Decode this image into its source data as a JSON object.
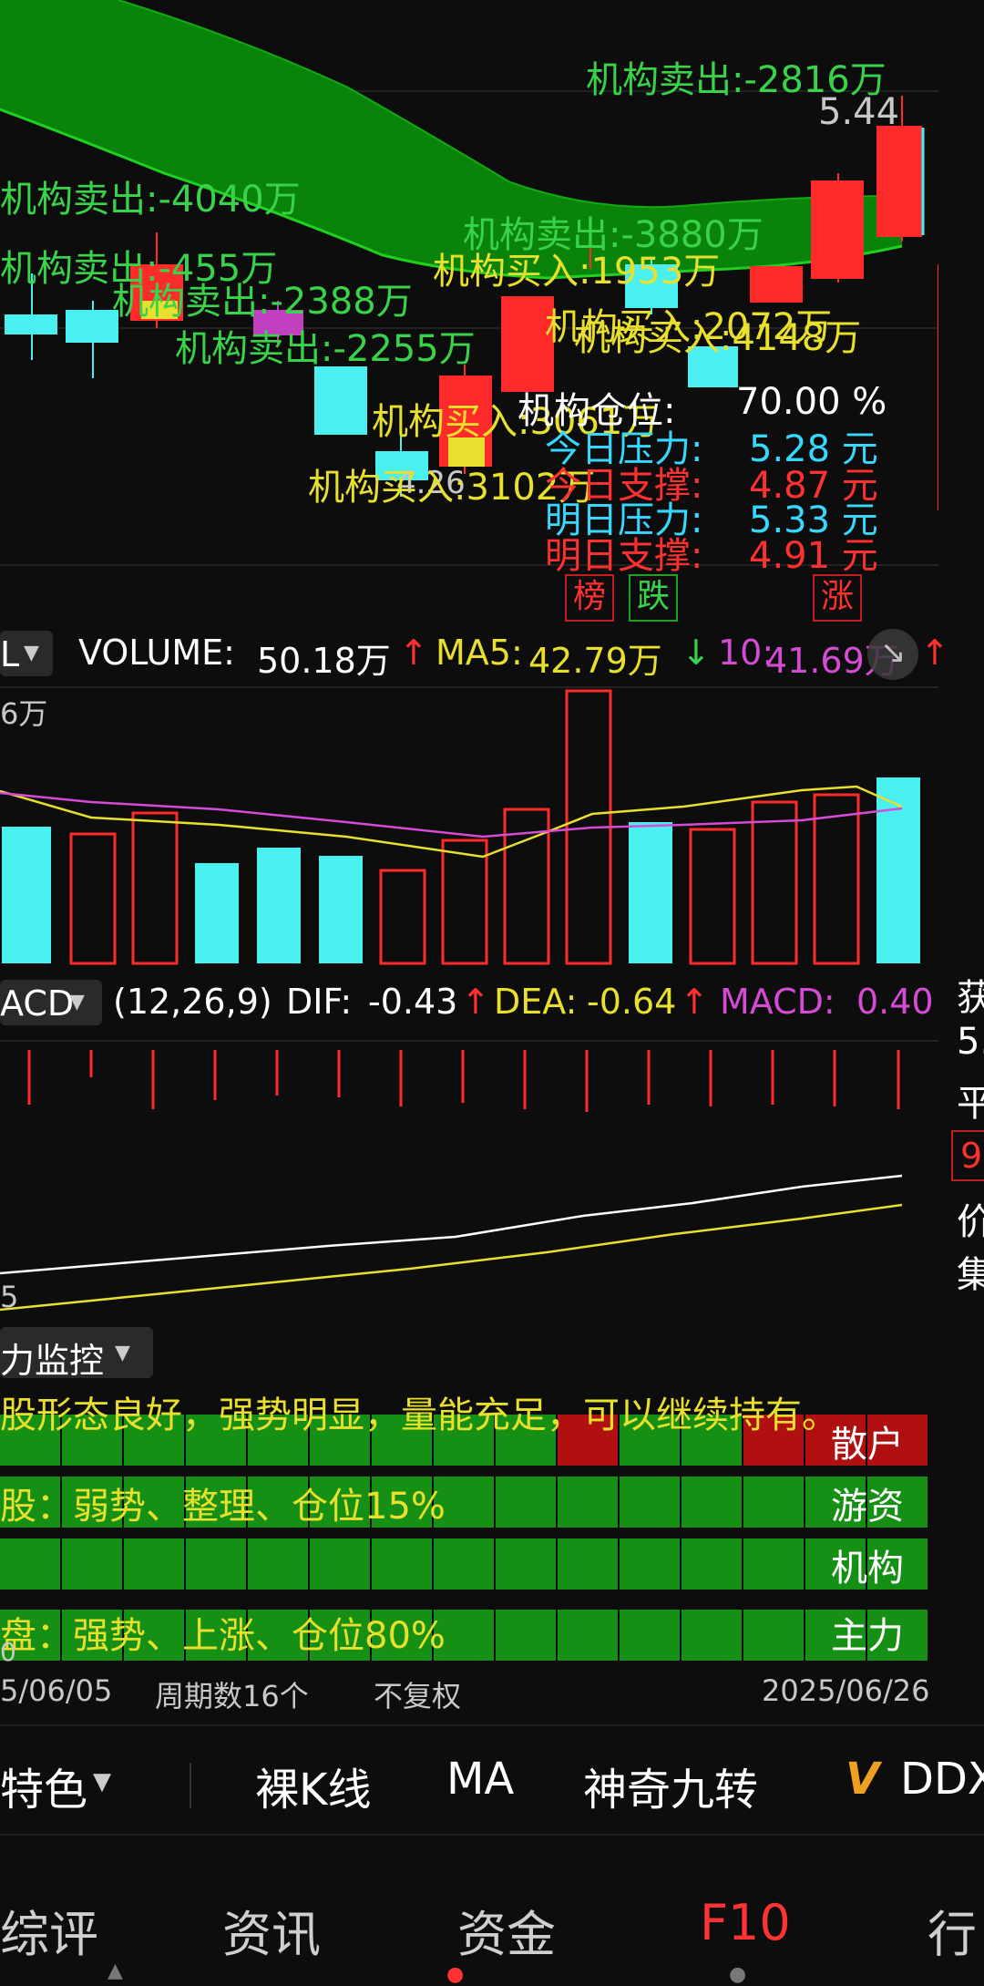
{
  "price_chart": {
    "price_high": "5.44",
    "price_low": "4.26",
    "annotations": [
      {
        "text": "机构卖出:-2816万",
        "color": "green"
      },
      {
        "text": "机构卖出:-4040万",
        "color": "green"
      },
      {
        "text": "机构卖出:-3880万",
        "color": "green"
      },
      {
        "text": "机构卖出:-455万",
        "color": "green"
      },
      {
        "text": "机构买入:1953万",
        "color": "yellow"
      },
      {
        "text": "机构卖出:-2388万",
        "color": "green"
      },
      {
        "text": "机构买入:2072万",
        "color": "yellow"
      },
      {
        "text": "机构买入:4148万",
        "color": "yellow"
      },
      {
        "text": "机构卖出:-2255万",
        "color": "green"
      },
      {
        "text": "机构买入:3061万",
        "color": "yellow"
      },
      {
        "text": "机构买入:3102万",
        "color": "yellow"
      }
    ],
    "stats": {
      "position_label": "机构仓位:",
      "position_value": "70.00 %",
      "today_pressure_label": "今日压力:",
      "today_pressure_value": "5.28 元",
      "today_support_label": "今日支撑:",
      "today_support_value": "4.87 元",
      "tomorrow_pressure_label": "明日压力:",
      "tomorrow_pressure_value": "5.33 元",
      "tomorrow_support_label": "明日支撑:",
      "tomorrow_support_value": "4.91 元"
    },
    "badges": [
      "榜",
      "跌",
      "涨"
    ]
  },
  "volume_panel": {
    "selector": "L",
    "volume_label": "VOLUME:",
    "volume_value": "50.18万",
    "ma5_label": "MA5:",
    "ma5_value": "42.79万",
    "ma10_label": "10:",
    "ma10_value": "41.69万",
    "axis_label": "6万"
  },
  "macd_panel": {
    "selector": "ACD",
    "params": "(12,26,9)",
    "dif_label": "DIF:",
    "dif_value": "-0.43",
    "dea_label": "DEA:",
    "dea_value": "-0.64",
    "macd_label": "MACD:",
    "macd_value": "0.40",
    "axis_label": "5"
  },
  "side_panel": [
    "获",
    "5.",
    "平",
    "9",
    "价",
    "集"
  ],
  "monitor_panel": {
    "title": "力监控",
    "message": "股形态良好，强势明显，量能充足，可以继续持有。",
    "rows": [
      {
        "label": "散户",
        "text": ""
      },
      {
        "label": "游资",
        "text": "股：弱势、整理、仓位15%"
      },
      {
        "label": "机构",
        "text": ""
      },
      {
        "label": "主力",
        "text": "盘：强势、上涨、仓位80%"
      }
    ],
    "axis_label": "0"
  },
  "footer_info": {
    "start_date": "5/06/05",
    "period_count": "周期数16个",
    "adjust": "不复权",
    "end_date": "2025/06/26"
  },
  "toolbar": {
    "feature": "特色",
    "items": [
      "裸K线",
      "MA",
      "神奇九转",
      "DDX"
    ],
    "ddx_prefix": "V"
  },
  "tabs": [
    {
      "label": "综评",
      "active": false
    },
    {
      "label": "资讯",
      "active": false
    },
    {
      "label": "资金",
      "active": false
    },
    {
      "label": "F10",
      "active": true
    },
    {
      "label": "行",
      "active": false
    }
  ],
  "colors": {
    "background": "#0d0d0d",
    "up_red": "#ff2a2a",
    "down_cyan": "#4af0f0",
    "label_green": "#39d34a",
    "label_yellow": "#e8e02c",
    "band_green": "#0a8a0a",
    "tab_active": "#ff3333"
  }
}
